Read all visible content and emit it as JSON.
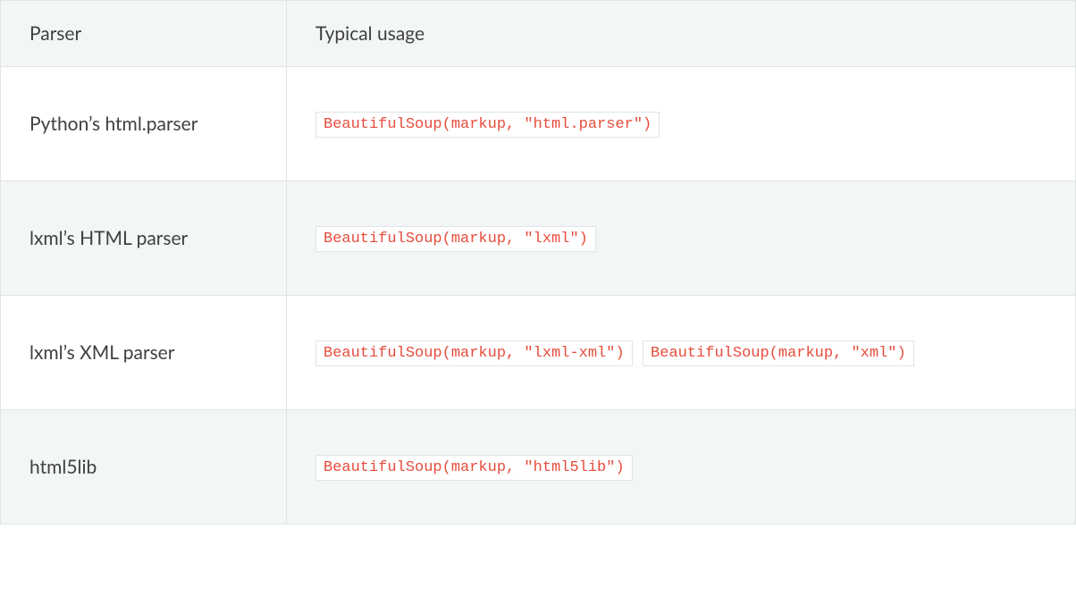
{
  "table": {
    "headers": {
      "parser": "Parser",
      "usage": "Typical usage"
    },
    "rows": [
      {
        "parser": "Python’s html.parser",
        "usages": [
          "BeautifulSoup(markup, \"html.parser\")"
        ]
      },
      {
        "parser": "lxml’s HTML parser",
        "usages": [
          "BeautifulSoup(markup, \"lxml\")"
        ]
      },
      {
        "parser": "lxml’s XML parser",
        "usages": [
          "BeautifulSoup(markup, \"lxml-xml\")",
          "BeautifulSoup(markup, \"xml\")"
        ]
      },
      {
        "parser": "html5lib",
        "usages": [
          "BeautifulSoup(markup, \"html5lib\")"
        ]
      }
    ]
  }
}
